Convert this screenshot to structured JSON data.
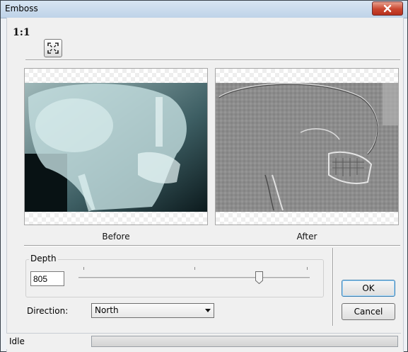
{
  "window": {
    "title": "Emboss"
  },
  "toolbar": {
    "zoom_label": "1:1",
    "fit_icon": "fit-screen-icon"
  },
  "preview": {
    "before_caption": "Before",
    "after_caption": "After"
  },
  "depth": {
    "label": "Depth",
    "value": "805",
    "slider_level": 0.78
  },
  "direction": {
    "label": "Direction:",
    "selected": "North"
  },
  "buttons": {
    "ok": "OK",
    "cancel": "Cancel"
  },
  "status": {
    "text": "Idle",
    "progress": 0
  }
}
